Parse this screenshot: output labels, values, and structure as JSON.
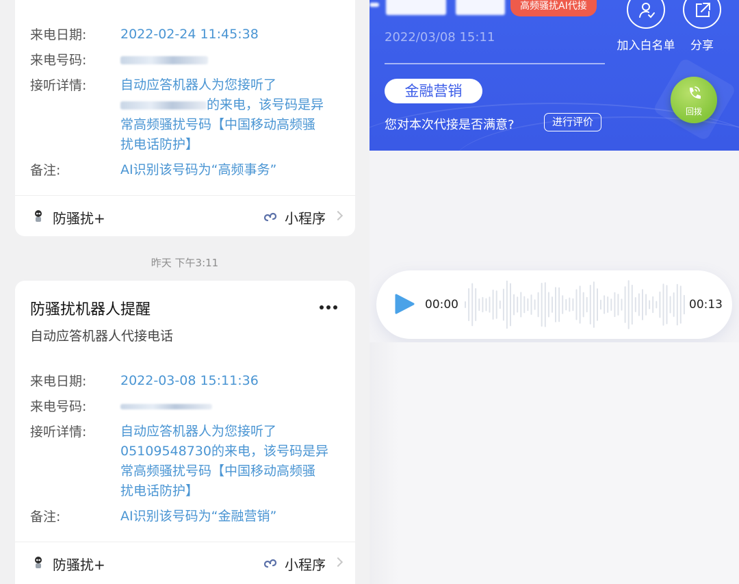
{
  "left": {
    "timestamp": "昨天 下午3:11",
    "cards": [
      {
        "rows": [
          {
            "label": "来电日期:",
            "value": "2022-02-24 11:45:38"
          },
          {
            "label": "来电号码:",
            "value": ""
          },
          {
            "label": "接听详情:",
            "value_line1": "自动应答机器人为您接听了",
            "value_line2_suffix": "的来电，该号码是异",
            "value_line3": "常高频骚扰号码【中国移动高频骚",
            "value_line4": "扰电话防护】"
          },
          {
            "label": "备注:",
            "value": "AI识别该号码为“高频事务”"
          }
        ],
        "footer": {
          "app_label": "防骚扰+",
          "mini_label": "小程序"
        }
      },
      {
        "title": "防骚扰机器人提醒",
        "subtitle": "自动应答机器人代接电话",
        "rows": [
          {
            "label": "来电日期:",
            "value": "2022-03-08 15:11:36"
          },
          {
            "label": "来电号码:",
            "value": ""
          },
          {
            "label": "接听详情:",
            "value_line1": "自动应答机器人为您接听了",
            "value_line2": "05109548730的来电，该号码是异",
            "value_line3": "常高频骚扰号码【中国移动高频骚",
            "value_line4": "扰电话防护】"
          },
          {
            "label": "备注:",
            "value": "AI识别该号码为“金融营销”"
          }
        ],
        "footer": {
          "app_label": "防骚扰+",
          "mini_label": "小程序"
        }
      }
    ]
  },
  "right": {
    "tag": "高频骚扰AI代接",
    "call_time": "2022/03/08 15:11",
    "whitelist_label": "加入白名单",
    "share_label": "分享",
    "category": "金融营销",
    "satisfaction_question": "您对本次代接是否满意?",
    "rate_button": "进行评价",
    "callback_label": "回拨",
    "audio": {
      "current": "00:00",
      "duration": "00:13",
      "progress": 0
    }
  },
  "colors": {
    "banner_blue": "#3d5ee8",
    "tag_red": "#ee5b4b",
    "link_blue": "#4a95d3",
    "callback_green": "#8cc83f"
  },
  "icons": [
    "robot-icon",
    "mini-program-icon",
    "chevron-right-icon",
    "more-icon",
    "user-check-icon",
    "share-icon",
    "phone-icon",
    "play-icon"
  ]
}
